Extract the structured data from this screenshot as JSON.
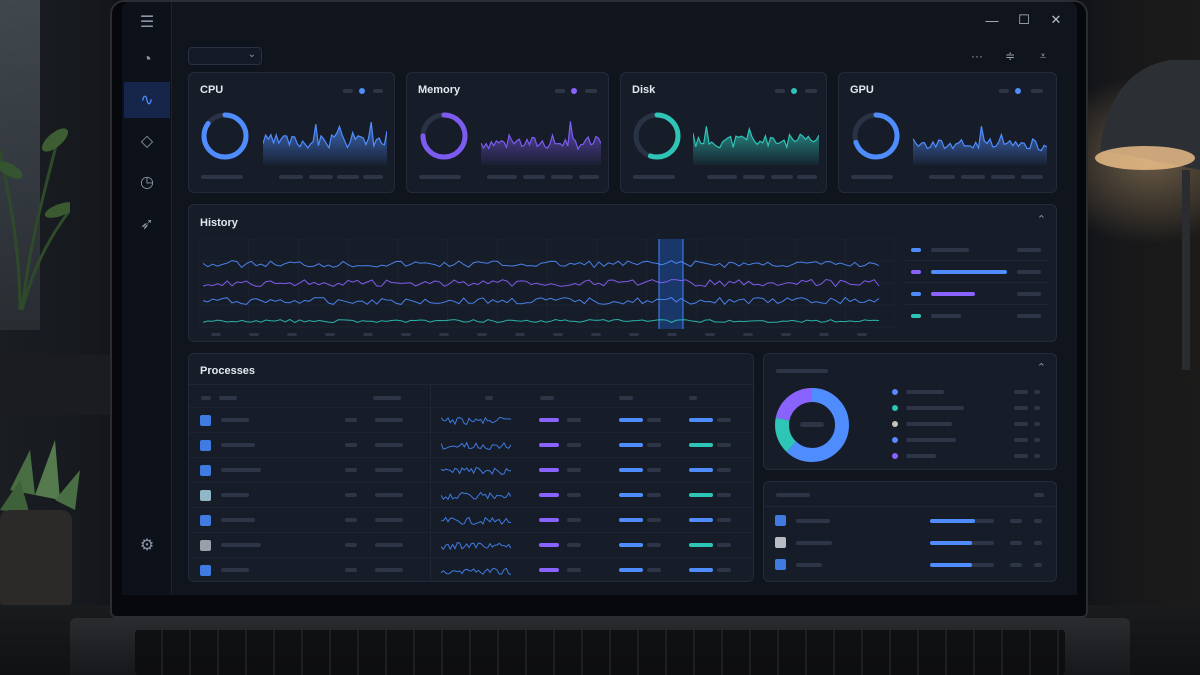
{
  "window": {
    "controls": [
      "minimize",
      "maximize",
      "close"
    ],
    "minimize_glyph": "—",
    "maximize_glyph": "☐",
    "close_glyph": "✕"
  },
  "sidebar": {
    "items": [
      {
        "icon": "menu-icon",
        "glyph": "☰"
      },
      {
        "icon": "speedometer-icon",
        "glyph": "◔"
      },
      {
        "icon": "activity-icon",
        "glyph": "∿",
        "active": true
      },
      {
        "icon": "layers-icon",
        "glyph": "◇"
      },
      {
        "icon": "clock-icon",
        "glyph": "◷"
      },
      {
        "icon": "rocket-icon",
        "glyph": "➶"
      },
      {
        "icon": "settings-icon",
        "glyph": "⚙"
      }
    ]
  },
  "toolbar": {
    "select_value": "",
    "chevron": "⌄",
    "more_glyph": "···",
    "network_glyph": "≑",
    "filter_glyph": "⩡"
  },
  "cards": [
    {
      "title": "CPU",
      "accent": "#4f8dff",
      "ring_fill": 0.85,
      "dot": "#4f8dff"
    },
    {
      "title": "Memory",
      "accent": "#7c5cf0",
      "ring_fill": 0.75,
      "dot": "#8a63ff"
    },
    {
      "title": "Disk",
      "accent": "#2ec4b6",
      "ring_fill": 0.55,
      "dot": "#2ec4b6"
    },
    {
      "title": "GPU",
      "accent": "#4f8dff",
      "ring_fill": 0.7,
      "dot": "#4f8dff"
    }
  ],
  "history": {
    "title": "History",
    "collapse_glyph": "⌃",
    "legend_colors": [
      "#4f8dff",
      "#8a63ff",
      "#4f8dff",
      "#2ec4b6"
    ],
    "legend_bar_fill": [
      0.0,
      0.78,
      0.44,
      0.0
    ]
  },
  "processes": {
    "title": "Processes",
    "icon_colors": [
      "#3f7be0",
      "#3f7be0",
      "#3f7be0",
      "#8fb7c6",
      "#3f7be0",
      "#9aa0aa",
      "#3f7be0"
    ]
  },
  "donut": {
    "collapse_glyph": "⌃",
    "segments": [
      {
        "color": "#4f8dff",
        "fraction": 0.62
      },
      {
        "color": "#2ec4b6",
        "fraction": 0.16
      },
      {
        "color": "#8a63ff",
        "fraction": 0.22
      }
    ],
    "legend_colors": [
      "#4f8dff",
      "#2ec4b6",
      "#c9c3bb",
      "#4f8dff",
      "#8a63ff"
    ]
  },
  "devices": {
    "icon_colors": [
      "#3f7be0",
      "#b9bcc3",
      "#3f7be0"
    ],
    "bar_fill": [
      0.7,
      0.66,
      0.66
    ]
  }
}
